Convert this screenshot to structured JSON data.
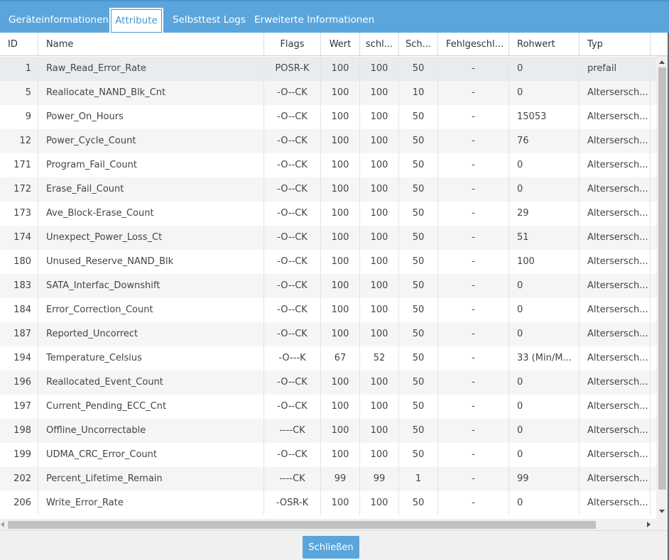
{
  "tabs": [
    {
      "label": "Geräteinformationen"
    },
    {
      "label": "Attribute"
    },
    {
      "label": "Selbsttest Logs"
    },
    {
      "label": "Erweiterte Informationen"
    }
  ],
  "active_tab": "Attribute",
  "columns": [
    "ID",
    "Name",
    "Flags",
    "Wert",
    "schl...",
    "Sch...",
    "Fehlgeschl...",
    "Rohwert",
    "Typ"
  ],
  "rows": [
    {
      "id": "1",
      "name": "Raw_Read_Error_Rate",
      "flags": "POSR-K",
      "wert": "100",
      "schl": "100",
      "sch": "50",
      "fehl": "-",
      "roh": "0",
      "typ": "prefail"
    },
    {
      "id": "5",
      "name": "Reallocate_NAND_Blk_Cnt",
      "flags": "-O--CK",
      "wert": "100",
      "schl": "100",
      "sch": "10",
      "fehl": "-",
      "roh": "0",
      "typ": "Altersersch..."
    },
    {
      "id": "9",
      "name": "Power_On_Hours",
      "flags": "-O--CK",
      "wert": "100",
      "schl": "100",
      "sch": "50",
      "fehl": "-",
      "roh": "15053",
      "typ": "Altersersch..."
    },
    {
      "id": "12",
      "name": "Power_Cycle_Count",
      "flags": "-O--CK",
      "wert": "100",
      "schl": "100",
      "sch": "50",
      "fehl": "-",
      "roh": "76",
      "typ": "Altersersch..."
    },
    {
      "id": "171",
      "name": "Program_Fail_Count",
      "flags": "-O--CK",
      "wert": "100",
      "schl": "100",
      "sch": "50",
      "fehl": "-",
      "roh": "0",
      "typ": "Altersersch..."
    },
    {
      "id": "172",
      "name": "Erase_Fail_Count",
      "flags": "-O--CK",
      "wert": "100",
      "schl": "100",
      "sch": "50",
      "fehl": "-",
      "roh": "0",
      "typ": "Altersersch..."
    },
    {
      "id": "173",
      "name": "Ave_Block-Erase_Count",
      "flags": "-O--CK",
      "wert": "100",
      "schl": "100",
      "sch": "50",
      "fehl": "-",
      "roh": "29",
      "typ": "Altersersch..."
    },
    {
      "id": "174",
      "name": "Unexpect_Power_Loss_Ct",
      "flags": "-O--CK",
      "wert": "100",
      "schl": "100",
      "sch": "50",
      "fehl": "-",
      "roh": "51",
      "typ": "Altersersch..."
    },
    {
      "id": "180",
      "name": "Unused_Reserve_NAND_Blk",
      "flags": "-O--CK",
      "wert": "100",
      "schl": "100",
      "sch": "50",
      "fehl": "-",
      "roh": "100",
      "typ": "Altersersch..."
    },
    {
      "id": "183",
      "name": "SATA_Interfac_Downshift",
      "flags": "-O--CK",
      "wert": "100",
      "schl": "100",
      "sch": "50",
      "fehl": "-",
      "roh": "0",
      "typ": "Altersersch..."
    },
    {
      "id": "184",
      "name": "Error_Correction_Count",
      "flags": "-O--CK",
      "wert": "100",
      "schl": "100",
      "sch": "50",
      "fehl": "-",
      "roh": "0",
      "typ": "Altersersch..."
    },
    {
      "id": "187",
      "name": "Reported_Uncorrect",
      "flags": "-O--CK",
      "wert": "100",
      "schl": "100",
      "sch": "50",
      "fehl": "-",
      "roh": "0",
      "typ": "Altersersch..."
    },
    {
      "id": "194",
      "name": "Temperature_Celsius",
      "flags": "-O---K",
      "wert": "67",
      "schl": "52",
      "sch": "50",
      "fehl": "-",
      "roh": "33 (Min/M...",
      "typ": "Altersersch..."
    },
    {
      "id": "196",
      "name": "Reallocated_Event_Count",
      "flags": "-O--CK",
      "wert": "100",
      "schl": "100",
      "sch": "50",
      "fehl": "-",
      "roh": "0",
      "typ": "Altersersch..."
    },
    {
      "id": "197",
      "name": "Current_Pending_ECC_Cnt",
      "flags": "-O--CK",
      "wert": "100",
      "schl": "100",
      "sch": "50",
      "fehl": "-",
      "roh": "0",
      "typ": "Altersersch..."
    },
    {
      "id": "198",
      "name": "Offline_Uncorrectable",
      "flags": "----CK",
      "wert": "100",
      "schl": "100",
      "sch": "50",
      "fehl": "-",
      "roh": "0",
      "typ": "Altersersch..."
    },
    {
      "id": "199",
      "name": "UDMA_CRC_Error_Count",
      "flags": "-O--CK",
      "wert": "100",
      "schl": "100",
      "sch": "50",
      "fehl": "-",
      "roh": "0",
      "typ": "Altersersch..."
    },
    {
      "id": "202",
      "name": "Percent_Lifetime_Remain",
      "flags": "----CK",
      "wert": "99",
      "schl": "99",
      "sch": "1",
      "fehl": "-",
      "roh": "99",
      "typ": "Altersersch..."
    },
    {
      "id": "206",
      "name": "Write_Error_Rate",
      "flags": "-OSR-K",
      "wert": "100",
      "schl": "100",
      "sch": "50",
      "fehl": "-",
      "roh": "0",
      "typ": "Altersersch..."
    }
  ],
  "footer": {
    "close_label": "Schließen"
  },
  "colors": {
    "accent": "#5aa6dc",
    "accent_dark": "#4a96cc",
    "row_alt": "#f5f5f5",
    "row_selected": "#e9ecef"
  }
}
